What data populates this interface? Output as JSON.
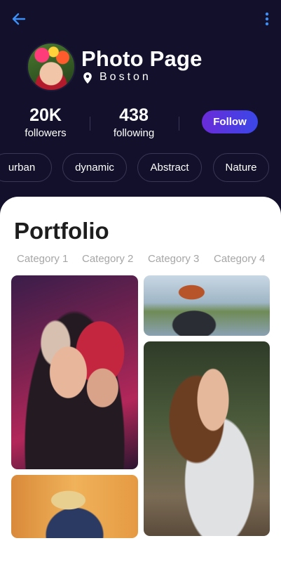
{
  "header": {
    "back_icon": "arrow-left-icon",
    "more_icon": "more-vertical-icon",
    "accent_color": "#3d8ff5"
  },
  "profile": {
    "title": "Photo Page",
    "location": "Boston",
    "location_icon": "map-pin-icon"
  },
  "stats": [
    {
      "value": "20K",
      "label": "followers"
    },
    {
      "value": "438",
      "label": "following"
    }
  ],
  "follow_button": {
    "label": "Follow",
    "colors": [
      "#6a2bd9",
      "#3a47e8"
    ]
  },
  "tags": [
    "urban",
    "dynamic",
    "Abstract",
    "Nature"
  ],
  "portfolio": {
    "title": "Portfolio",
    "categories": [
      "Category 1",
      "Category 2",
      "Category 3",
      "Category 4"
    ]
  }
}
